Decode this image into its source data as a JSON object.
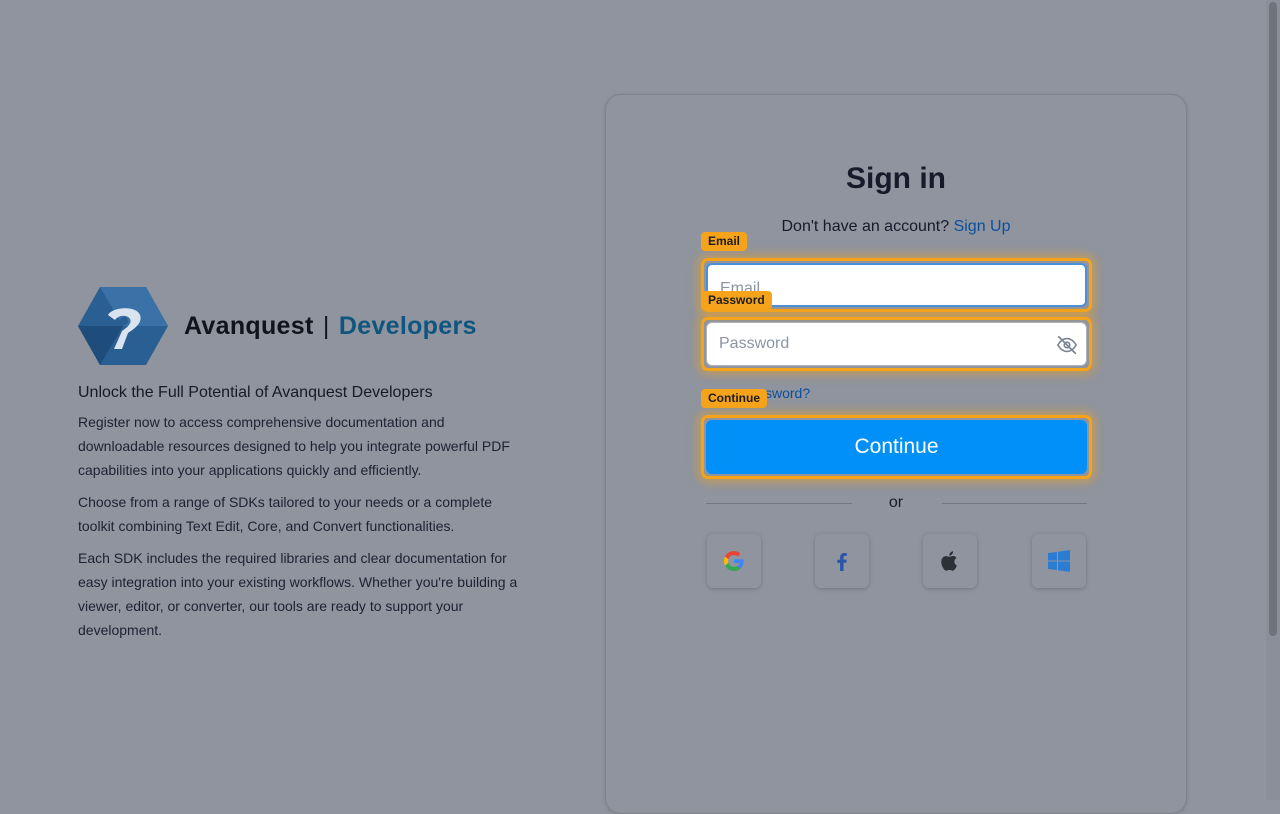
{
  "brand": {
    "name": "Avanquest",
    "separator": "|",
    "suffix": "Developers"
  },
  "intro": {
    "heading": "Unlock the Full Potential of Avanquest Developers",
    "paragraphs": [
      "Register now to access comprehensive documentation and downloadable resources designed to help you integrate powerful PDF capabilities into your applications quickly and efficiently.",
      "Choose from a range of SDKs tailored to your needs or a complete toolkit combining Text Edit, Core, and Convert functionalities.",
      "Each SDK includes the required libraries and clear documentation for easy integration into your existing workflows. Whether you're building a viewer, editor, or converter, our tools are ready to support your development."
    ]
  },
  "signin": {
    "title": "Sign in",
    "no_account_text": "Don't have an account?",
    "signup_link": "Sign Up",
    "email_placeholder": "Email",
    "password_placeholder": "Password",
    "forgot_password": "ssword?",
    "continue_label": "Continue",
    "divider": "or"
  },
  "social": {
    "google_icon": "google-icon",
    "facebook_icon": "facebook-icon",
    "apple_icon": "apple-icon",
    "windows_icon": "windows-icon"
  },
  "highlights": {
    "email": "Email",
    "password": "Password",
    "continue": "Continue"
  },
  "colors": {
    "primary_button": "#0090f8",
    "link": "#0b4f9c",
    "highlight": "#f5a31a",
    "brand_accent": "#0f557f",
    "overlay_bg": "#8f949e"
  }
}
